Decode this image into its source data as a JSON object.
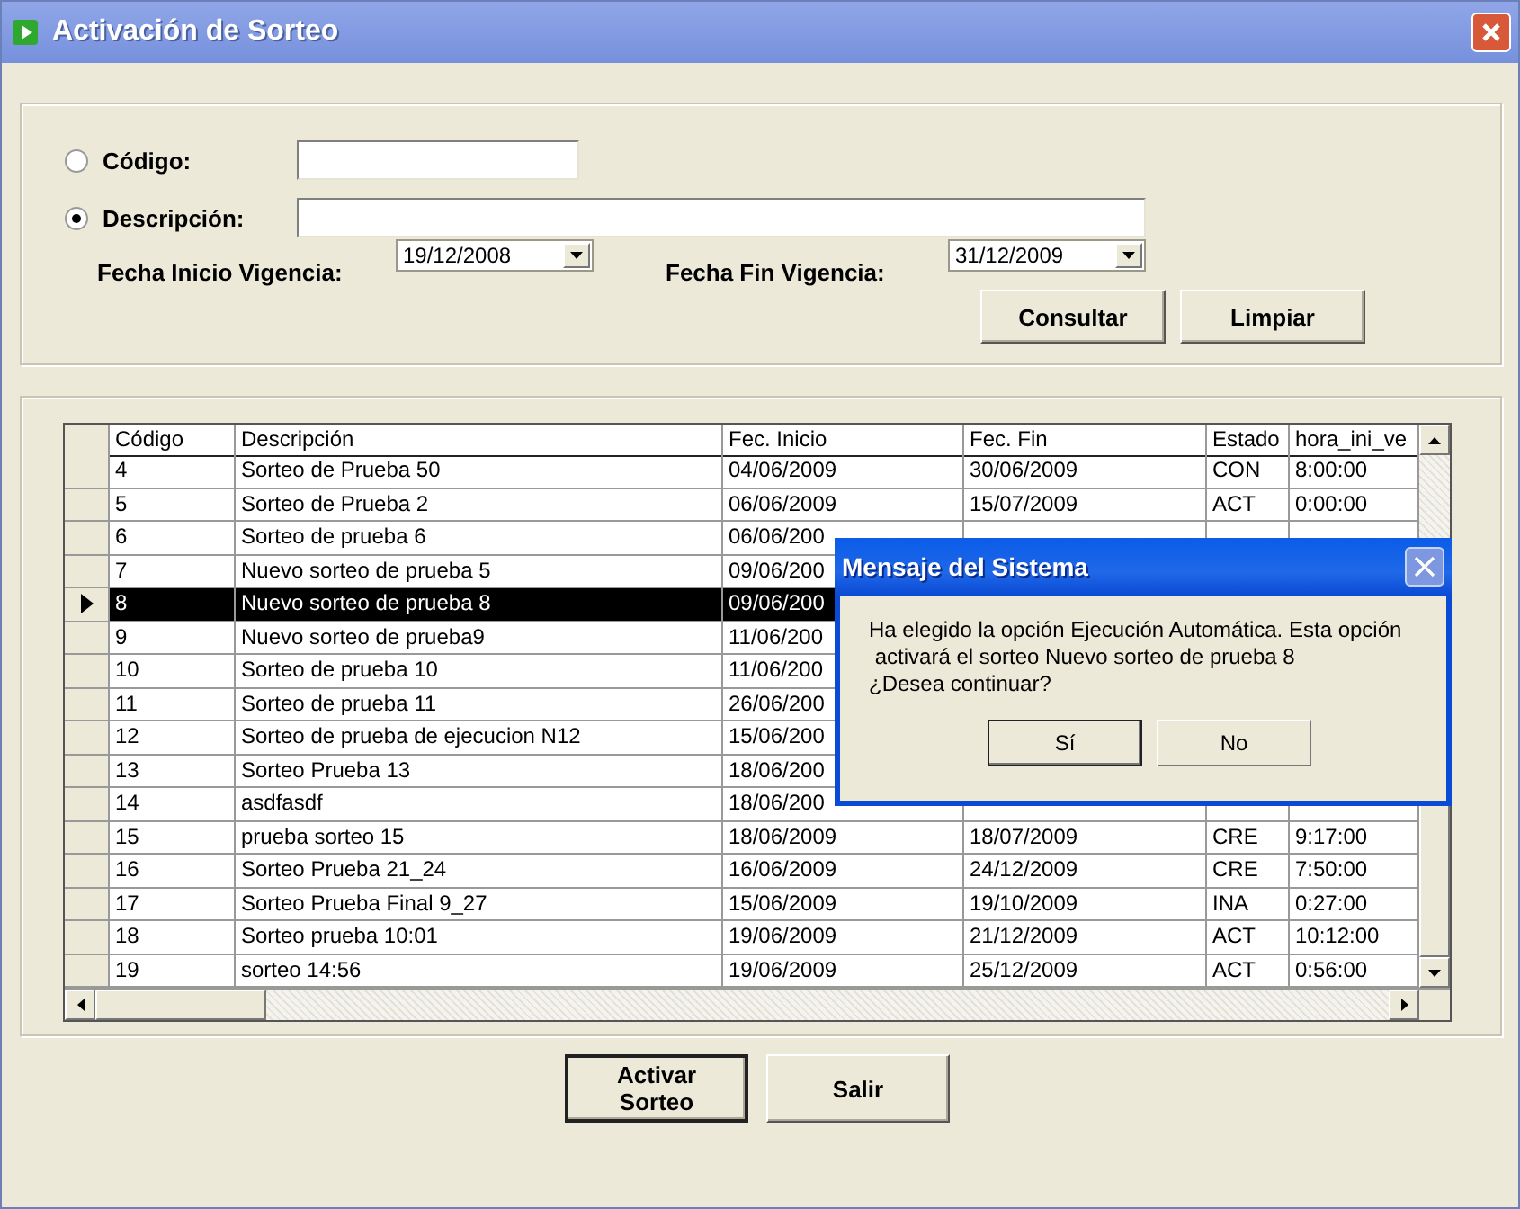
{
  "window": {
    "title": "Activación de Sorteo"
  },
  "filters": {
    "options": [
      {
        "label": "Código:",
        "selected": false
      },
      {
        "label": "Descripción:",
        "selected": true
      }
    ],
    "dates": [
      {
        "label": "Fecha Inicio Vigencia:",
        "value": "19/12/2008"
      },
      {
        "label": "Fecha Fin Vigencia:",
        "value": "31/12/2009"
      }
    ],
    "buttons": [
      "Consultar",
      "Limpiar"
    ]
  },
  "table": {
    "columns": [
      "Código",
      "Descripción",
      "Fec. Inicio",
      "Fec. Fin",
      "Estado",
      "hora_ini_ve"
    ],
    "rows": [
      {
        "cells": [
          "4",
          "Sorteo de Prueba 50",
          "04/06/2009",
          "30/06/2009",
          "CON",
          "8:00:00"
        ],
        "selected": false
      },
      {
        "cells": [
          "5",
          "Sorteo de Prueba 2",
          "06/06/2009",
          "15/07/2009",
          "ACT",
          "0:00:00"
        ],
        "selected": false
      },
      {
        "cells": [
          "6",
          "Sorteo de prueba 6",
          "06/06/200"
        ],
        "selected": false
      },
      {
        "cells": [
          "7",
          "Nuevo sorteo de prueba 5",
          "09/06/200"
        ],
        "selected": false
      },
      {
        "cells": [
          "8",
          "Nuevo sorteo de prueba 8",
          "09/06/200"
        ],
        "selected": true
      },
      {
        "cells": [
          "9",
          "Nuevo sorteo de prueba9",
          "11/06/200"
        ],
        "selected": false
      },
      {
        "cells": [
          "10",
          "Sorteo de prueba 10",
          "11/06/200"
        ],
        "selected": false
      },
      {
        "cells": [
          "11",
          "Sorteo de prueba 11",
          "26/06/200"
        ],
        "selected": false
      },
      {
        "cells": [
          "12",
          "Sorteo de prueba de ejecucion N12",
          "15/06/200"
        ],
        "selected": false
      },
      {
        "cells": [
          "13",
          "Sorteo Prueba 13",
          "18/06/200"
        ],
        "selected": false
      },
      {
        "cells": [
          "14",
          "asdfasdf",
          "18/06/200"
        ],
        "selected": false
      },
      {
        "cells": [
          "15",
          "prueba sorteo 15",
          "18/06/2009",
          "18/07/2009",
          "CRE",
          "9:17:00"
        ],
        "selected": false
      },
      {
        "cells": [
          "16",
          "Sorteo Prueba 21_24",
          "16/06/2009",
          "24/12/2009",
          "CRE",
          "7:50:00"
        ],
        "selected": false
      },
      {
        "cells": [
          "17",
          "Sorteo Prueba Final 9_27",
          "15/06/2009",
          "19/10/2009",
          "INA",
          "0:27:00"
        ],
        "selected": false
      },
      {
        "cells": [
          "18",
          "Sorteo prueba 10:01",
          "19/06/2009",
          "21/12/2009",
          "ACT",
          "10:12:00"
        ],
        "selected": false
      },
      {
        "cells": [
          "19",
          "sorteo 14:56",
          "19/06/2009",
          "25/12/2009",
          "ACT",
          "0:56:00"
        ],
        "selected": false
      }
    ]
  },
  "buttons": [
    "Activar Sorteo",
    "Salir"
  ],
  "dialog": {
    "title": "Mensaje del Sistema",
    "message": "Ha elegido la opción Ejecución Automática. Esta opción\n activará el sorteo Nuevo sorteo de prueba 8\n¿Desea continuar?",
    "buttons": [
      {
        "label": "Sí",
        "default": true
      },
      {
        "label": "No",
        "default": false
      }
    ]
  }
}
